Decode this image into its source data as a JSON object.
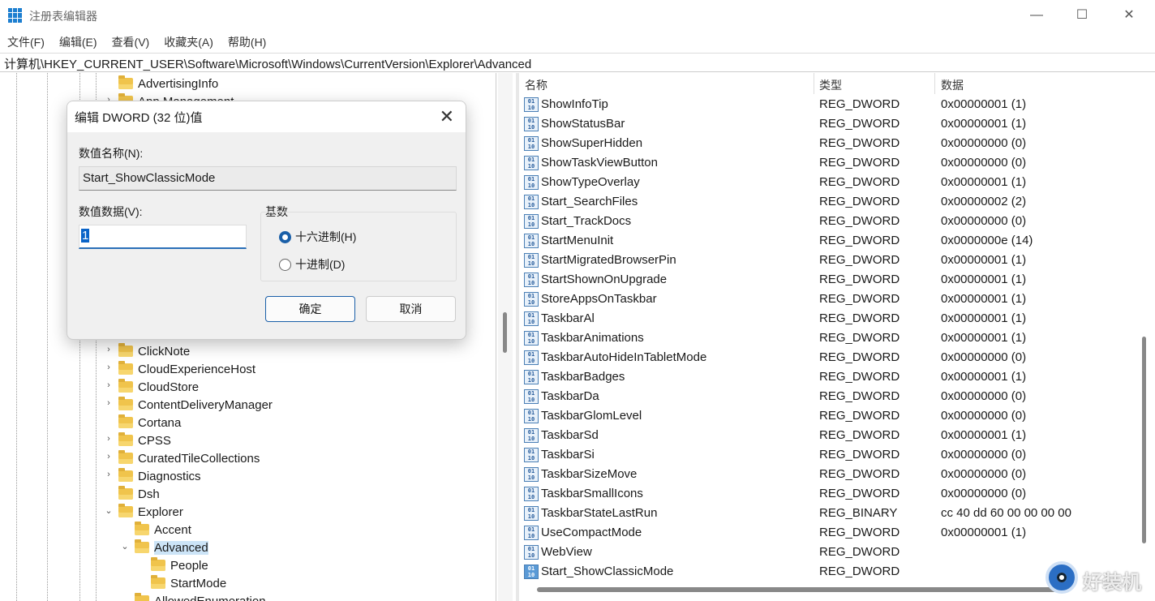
{
  "window": {
    "title": "注册表编辑器",
    "minimize": "—",
    "maximize": "☐",
    "close": "✕"
  },
  "menu": [
    "文件(F)",
    "编辑(E)",
    "查看(V)",
    "收藏夹(A)",
    "帮助(H)"
  ],
  "address": "计算机\\HKEY_CURRENT_USER\\Software\\Microsoft\\Windows\\CurrentVersion\\Explorer\\Advanced",
  "tree": [
    {
      "label": "AdvertisingInfo",
      "level": 1,
      "exp": ""
    },
    {
      "label": "App Management",
      "level": 1,
      "exp": "›"
    },
    {
      "label": "ClickNote",
      "level": 1,
      "exp": "›"
    },
    {
      "label": "CloudExperienceHost",
      "level": 1,
      "exp": "›"
    },
    {
      "label": "CloudStore",
      "level": 1,
      "exp": "›"
    },
    {
      "label": "ContentDeliveryManager",
      "level": 1,
      "exp": "›"
    },
    {
      "label": "Cortana",
      "level": 1,
      "exp": ""
    },
    {
      "label": "CPSS",
      "level": 1,
      "exp": "›"
    },
    {
      "label": "CuratedTileCollections",
      "level": 1,
      "exp": "›"
    },
    {
      "label": "Diagnostics",
      "level": 1,
      "exp": "›"
    },
    {
      "label": "Dsh",
      "level": 1,
      "exp": ""
    },
    {
      "label": "Explorer",
      "level": 1,
      "exp": "⌄"
    },
    {
      "label": "Accent",
      "level": 2,
      "exp": ""
    },
    {
      "label": "Advanced",
      "level": 2,
      "exp": "⌄",
      "selected": true
    },
    {
      "label": "People",
      "level": 3,
      "exp": ""
    },
    {
      "label": "StartMode",
      "level": 3,
      "exp": ""
    },
    {
      "label": "AllowedEnumeration",
      "level": 2,
      "exp": ""
    }
  ],
  "list": {
    "headers": [
      "名称",
      "类型",
      "数据"
    ],
    "rows": [
      [
        "ShowInfoTip",
        "REG_DWORD",
        "0x00000001 (1)"
      ],
      [
        "ShowStatusBar",
        "REG_DWORD",
        "0x00000001 (1)"
      ],
      [
        "ShowSuperHidden",
        "REG_DWORD",
        "0x00000000 (0)"
      ],
      [
        "ShowTaskViewButton",
        "REG_DWORD",
        "0x00000000 (0)"
      ],
      [
        "ShowTypeOverlay",
        "REG_DWORD",
        "0x00000001 (1)"
      ],
      [
        "Start_SearchFiles",
        "REG_DWORD",
        "0x00000002 (2)"
      ],
      [
        "Start_TrackDocs",
        "REG_DWORD",
        "0x00000000 (0)"
      ],
      [
        "StartMenuInit",
        "REG_DWORD",
        "0x0000000e (14)"
      ],
      [
        "StartMigratedBrowserPin",
        "REG_DWORD",
        "0x00000001 (1)"
      ],
      [
        "StartShownOnUpgrade",
        "REG_DWORD",
        "0x00000001 (1)"
      ],
      [
        "StoreAppsOnTaskbar",
        "REG_DWORD",
        "0x00000001 (1)"
      ],
      [
        "TaskbarAl",
        "REG_DWORD",
        "0x00000001 (1)"
      ],
      [
        "TaskbarAnimations",
        "REG_DWORD",
        "0x00000001 (1)"
      ],
      [
        "TaskbarAutoHideInTabletMode",
        "REG_DWORD",
        "0x00000000 (0)"
      ],
      [
        "TaskbarBadges",
        "REG_DWORD",
        "0x00000001 (1)"
      ],
      [
        "TaskbarDa",
        "REG_DWORD",
        "0x00000000 (0)"
      ],
      [
        "TaskbarGlomLevel",
        "REG_DWORD",
        "0x00000000 (0)"
      ],
      [
        "TaskbarSd",
        "REG_DWORD",
        "0x00000001 (1)"
      ],
      [
        "TaskbarSi",
        "REG_DWORD",
        "0x00000000 (0)"
      ],
      [
        "TaskbarSizeMove",
        "REG_DWORD",
        "0x00000000 (0)"
      ],
      [
        "TaskbarSmallIcons",
        "REG_DWORD",
        "0x00000000 (0)"
      ],
      [
        "TaskbarStateLastRun",
        "REG_BINARY",
        "cc 40 dd 60 00 00 00 00"
      ],
      [
        "UseCompactMode",
        "REG_DWORD",
        "0x00000001 (1)"
      ],
      [
        "WebView",
        "REG_DWORD",
        ""
      ],
      [
        "Start_ShowClassicMode",
        "REG_DWORD",
        ""
      ]
    ]
  },
  "dialog": {
    "title": "编辑 DWORD (32 位)值",
    "name_label": "数值名称(N):",
    "name_value": "Start_ShowClassicMode",
    "data_label": "数值数据(V):",
    "data_value": "1",
    "base_label": "基数",
    "hex_label": "十六进制(H)",
    "dec_label": "十进制(D)",
    "selected_base": "hex",
    "ok": "确定",
    "cancel": "取消"
  },
  "watermark": "好装机"
}
